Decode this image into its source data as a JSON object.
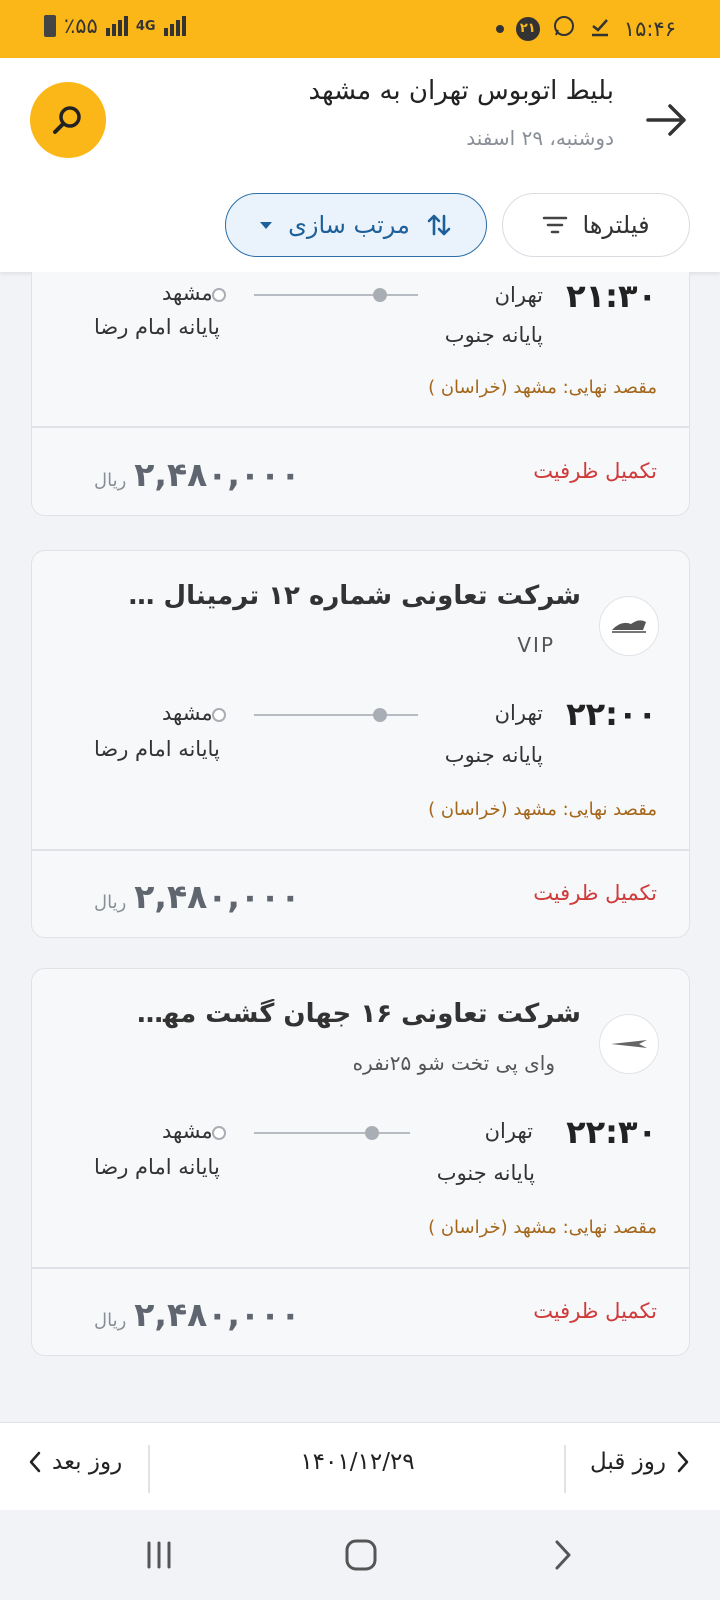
{
  "status_bar": {
    "time": "۱۵:۴۶",
    "notification_count": "۲۱",
    "battery": "٪۵۵",
    "network": "4G"
  },
  "header": {
    "title": "بلیط اتوبوس تهران به مشهد",
    "subtitle": "دوشنبه، ۲۹ اسفند",
    "filters_label": "فیلترها",
    "sort_label": "مرتب سازی"
  },
  "cards": [
    {
      "company": "",
      "bus_type": "",
      "departure_time": "۲۱:۳۰",
      "origin_city": "تهران",
      "origin_terminal": "پایانه جنوب",
      "destination_city": "مشهد",
      "destination_terminal": "پایانه امام رضا",
      "final_destination": "مقصد نهایی: مشهد (خراسان )",
      "status": "تکمیل ظرفیت",
      "price": "۲,۴۸۰,۰۰۰",
      "currency": "ریال"
    },
    {
      "company": "شرکت تعاونی شماره ۱۲ ترمینال جنوب",
      "bus_type": "VIP",
      "departure_time": "۲۲:۰۰",
      "origin_city": "تهران",
      "origin_terminal": "پایانه جنوب",
      "destination_city": "مشهد",
      "destination_terminal": "پایانه امام رضا",
      "final_destination": "مقصد نهایی: مشهد (خراسان )",
      "status": "تکمیل ظرفیت",
      "price": "۲,۴۸۰,۰۰۰",
      "currency": "ریال"
    },
    {
      "company": "شرکت تعاونی ۱۶ جهان گشت مهر- پایا...",
      "bus_type": "وای پی تخت شو ۲۵نفره",
      "departure_time": "۲۲:۳۰",
      "origin_city": "تهران",
      "origin_terminal": "پایانه جنوب",
      "destination_city": "مشهد",
      "destination_terminal": "پایانه امام رضا",
      "final_destination": "مقصد نهایی: مشهد (خراسان )",
      "status": "تکمیل ظرفیت",
      "price": "۲,۴۸۰,۰۰۰",
      "currency": "ریال"
    }
  ],
  "date_nav": {
    "next_day": "روز بعد",
    "prev_day": "روز قبل",
    "current_date": "۱۴۰۱/۱۲/۲۹"
  },
  "colors": {
    "brand": "#fbb718",
    "accent_blue": "#1d5f99",
    "full_status": "#d03a3a",
    "final_dest": "#a4661a"
  }
}
